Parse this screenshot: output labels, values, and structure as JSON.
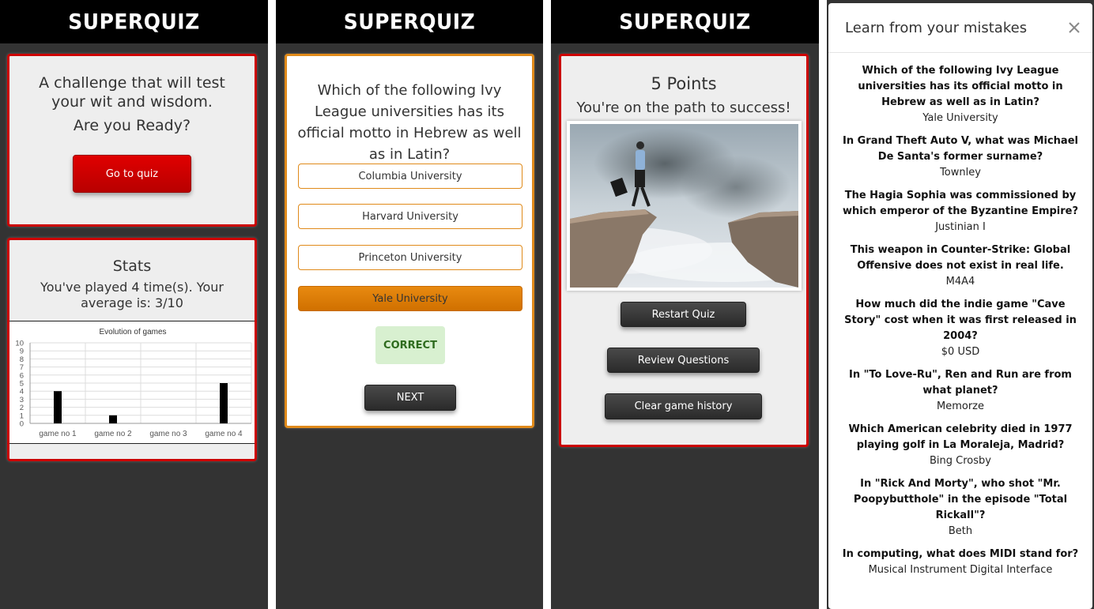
{
  "brand": "SUPERQUIZ",
  "home": {
    "tagline": "A challenge that will test your wit and wisdom.",
    "prompt": "Are you Ready?",
    "go_button": "Go to quiz",
    "stats_title": "Stats",
    "stats_text": "You've played 4 time(s). Your average is: 3/10"
  },
  "chart_data": {
    "type": "bar",
    "title": "Evolution of games",
    "categories": [
      "game no 1",
      "game no 2",
      "game no 3",
      "game no 4"
    ],
    "values": [
      4,
      1,
      0,
      5
    ],
    "ylim": [
      0,
      10
    ],
    "yticks": [
      "0",
      "1",
      "2",
      "3",
      "4",
      "5",
      "6",
      "7",
      "8",
      "9",
      "10"
    ],
    "grid": true,
    "bar_color": "#000000"
  },
  "question": {
    "text": "Which of the following Ivy League universities has its official motto in Hebrew as well as in Latin?",
    "answers": [
      "Columbia University",
      "Harvard University",
      "Princeton University",
      "Yale University"
    ],
    "selected_index": 3,
    "result": "CORRECT",
    "next_button": "NEXT"
  },
  "result": {
    "points": "5 Points",
    "message": "You're on the path to success!",
    "restart_button": "Restart Quiz",
    "review_button": "Review Questions",
    "clear_button": "Clear game history"
  },
  "review": {
    "title": "Learn from your mistakes",
    "close_icon": "close-icon",
    "items": [
      {
        "q": "Which of the following Ivy League universities has its official motto in Hebrew as well as in Latin?",
        "a": "Yale University"
      },
      {
        "q": "In Grand Theft Auto V, what was Michael De Santa's former surname?",
        "a": "Townley"
      },
      {
        "q": "The Hagia Sophia was commissioned by which emperor of the Byzantine Empire?",
        "a": "Justinian I"
      },
      {
        "q": "This weapon in Counter-Strike: Global Offensive does not exist in real life.",
        "a": "M4A4"
      },
      {
        "q": "How much did the indie game \"Cave Story\" cost when it was first released in 2004?",
        "a": "$0 USD"
      },
      {
        "q": "In \"To Love-Ru\", Ren and Run are from what planet?",
        "a": "Memorze"
      },
      {
        "q": "Which American celebrity died in 1977 playing golf in La Moraleja, Madrid?",
        "a": "Bing Crosby"
      },
      {
        "q": "In \"Rick And Morty\", who shot \"Mr. Poopybutthole\" in the episode \"Total Rickall\"?",
        "a": "Beth"
      },
      {
        "q": "In computing, what does MIDI stand for?",
        "a": "Musical Instrument Digital Interface"
      }
    ]
  }
}
